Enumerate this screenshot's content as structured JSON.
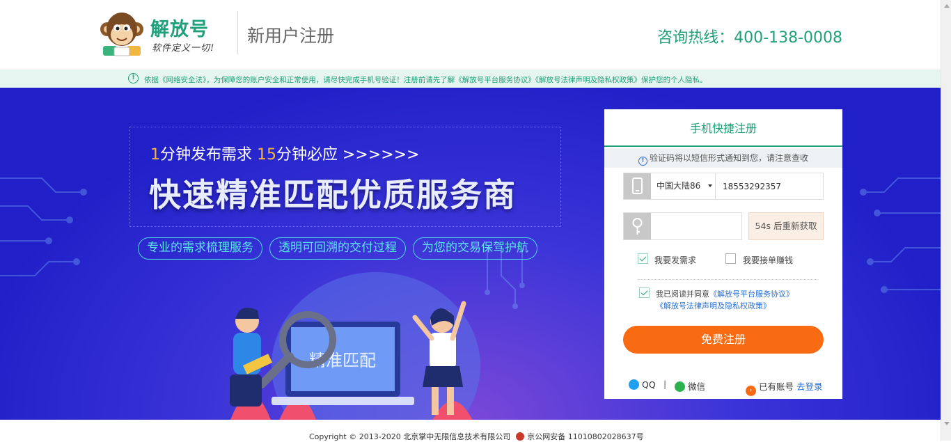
{
  "header": {
    "brand": "解放号",
    "slogan": "软件定义一切!",
    "page_title": "新用户注册",
    "hotline": "咨询热线：400-138-0008"
  },
  "notice": {
    "text": "依据《网络安全法》，为保障您的账户安全和正常使用，请尽快完成手机号验证！注册前请先了解《解放号平台服务协议》《解放号法律声明及隐私权政策》保护您的个人隐私。"
  },
  "banner": {
    "tagline_n1": "1",
    "tagline_t1": "分钟发布需求 ",
    "tagline_n2": "15",
    "tagline_t2": "分钟必应 >>>>>>",
    "headline": "快速精准匹配优质服务商",
    "pills": [
      "专业的需求梳理服务",
      "透明可回溯的交付过程",
      "为您的交易保驾护航"
    ],
    "screen_text": "精准匹配"
  },
  "register": {
    "title": "手机快捷注册",
    "tip": "验证码将以短信形式通知到您，请注意查收",
    "country": "中国大陆86",
    "phone_value": "18553292357",
    "code_value": "",
    "resend": "54s 后重新获取",
    "option_post": "我要发需求",
    "option_post_checked": true,
    "option_take": "我要接单赚钱",
    "option_take_checked": false,
    "agree_prefix": "我已阅读并同意",
    "agree_link1": "《解放号平台服务协议》",
    "agree_link2": "《解放号法律声明及隐私权政策》",
    "agree_checked": true,
    "submit": "免费注册",
    "qq": "QQ",
    "separator": "|",
    "wechat": "微信",
    "have_account": "已有账号",
    "login": "去登录"
  },
  "footer": {
    "copyright": "Copyright © 2013-2020 北京掌中无限信息技术有限公司",
    "icp": "京公网安备 11010802028637号"
  },
  "colors": {
    "brand_green": "#20a07a",
    "banner_blue": "#2120c8",
    "cta_orange": "#f86b12",
    "link_blue": "#2a6fd1"
  }
}
